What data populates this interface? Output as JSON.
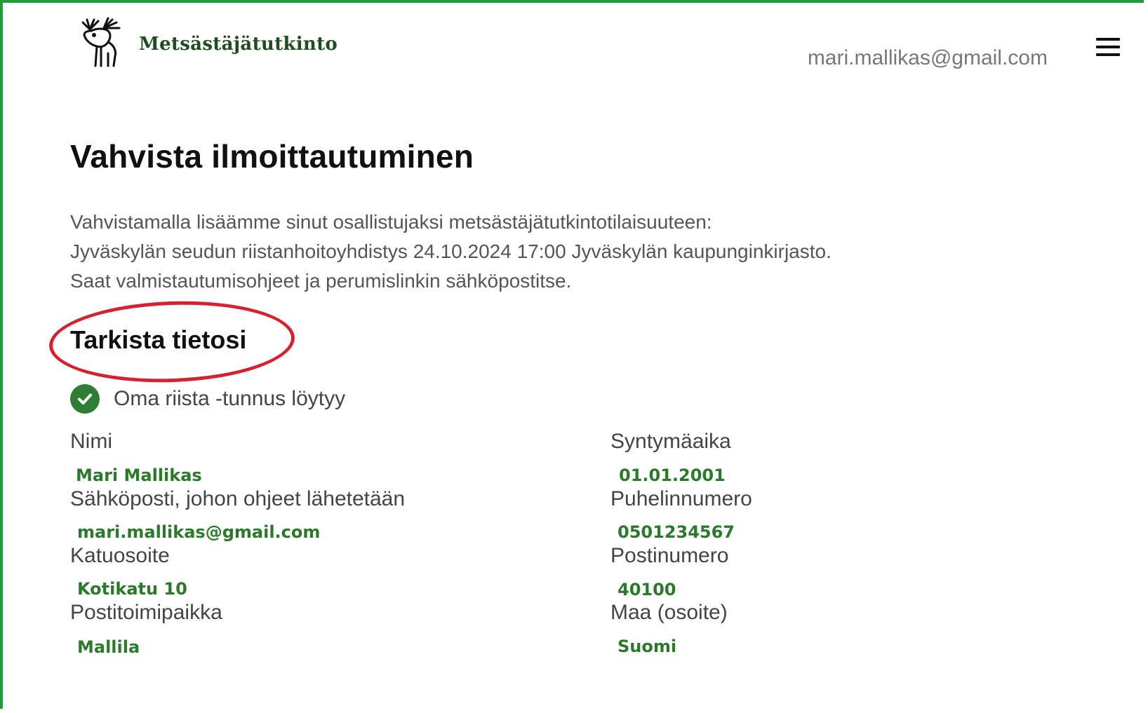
{
  "header": {
    "brand": "Metsästäjätutkinto",
    "user_email": "mari.mallikas@gmail.com",
    "menu_icon": "hamburger-menu-icon"
  },
  "page": {
    "title": "Vahvista ilmoittautuminen",
    "intro_lines": [
      "Vahvistamalla lisäämme sinut osallistujaksi metsästäjätutkintotilaisuuteen:",
      "Jyväskylän seudun riistanhoitoyhdistys 24.10.2024 17:00 Jyväskylän kaupunginkirjasto.",
      "Saat valmistautumisohjeet ja perumislinkin sähköpostitse."
    ]
  },
  "check": {
    "title": "Tarkista tietosi",
    "status_icon": "check-circle-icon",
    "status_text": "Oma riista -tunnus löytyy"
  },
  "fields": {
    "name": {
      "label": "Nimi",
      "value": "Mari Mallikas"
    },
    "birthdate": {
      "label": "Syntymäaika",
      "value": "01.01.2001"
    },
    "email": {
      "label": "Sähköposti, johon ohjeet lähetetään",
      "value": "mari.mallikas@gmail.com"
    },
    "phone": {
      "label": "Puhelinnumero",
      "value": "0501234567"
    },
    "street": {
      "label": "Katuosoite",
      "value": "Kotikatu 10"
    },
    "postal_code": {
      "label": "Postinumero",
      "value": "40100"
    },
    "city": {
      "label": "Postitoimipaikka",
      "value": "Mallila"
    },
    "country": {
      "label": "Maa (osoite)",
      "value": "Suomi"
    }
  },
  "colors": {
    "frame": "#1f9a3c",
    "brand": "#1e4d1e",
    "value": "#2b7a2b",
    "annotation": "#d6212f",
    "check": "#2e7d32"
  }
}
